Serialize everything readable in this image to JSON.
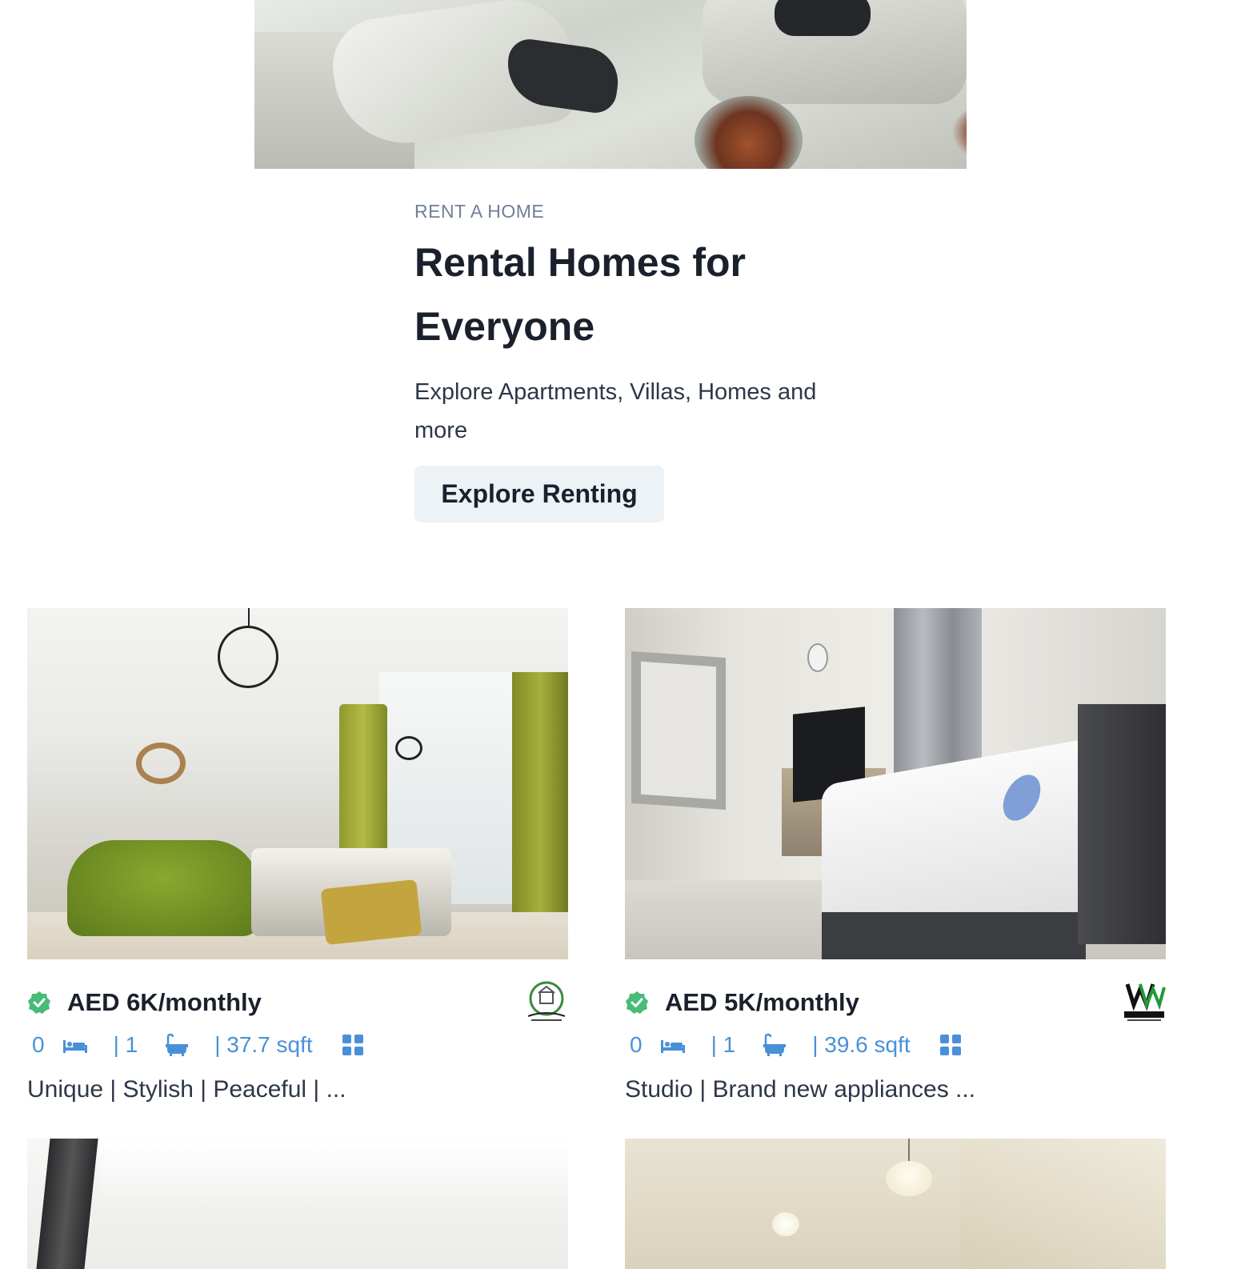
{
  "rent_section": {
    "eyebrow": "RENT A HOME",
    "title": "Rental Homes for Everyone",
    "subtitle": "Explore Apartments, Villas, Homes and more",
    "cta_label": "Explore Renting"
  },
  "listings": [
    {
      "price": "AED 6K/monthly",
      "beds": "0",
      "baths": "| 1",
      "area": "| 37.7 sqft",
      "headline": "Unique | Stylish | Peaceful | ...",
      "verified": true
    },
    {
      "price": "AED 5K/monthly",
      "beds": "0",
      "baths": "| 1",
      "area": "| 39.6 sqft",
      "headline": "Studio | Brand new appliances ...",
      "verified": true
    }
  ],
  "colors": {
    "accent_blue": "#4a90d9",
    "verified_green": "#48bb78",
    "cta_bg": "#edf2f7",
    "eyebrow": "#718096"
  },
  "icons": [
    "verified-badge-icon",
    "bed-icon",
    "bath-icon",
    "floorplan-icon"
  ]
}
